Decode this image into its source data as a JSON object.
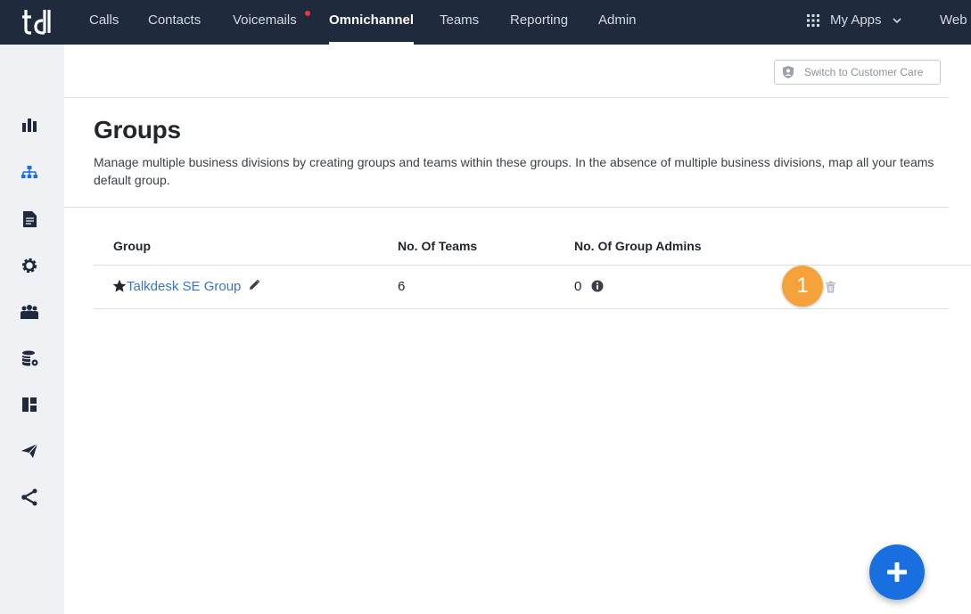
{
  "nav": {
    "items": [
      {
        "label": "Calls"
      },
      {
        "label": "Contacts"
      },
      {
        "label": "Voicemails"
      },
      {
        "label": "Omnichannel"
      },
      {
        "label": "Teams"
      },
      {
        "label": "Reporting"
      },
      {
        "label": "Admin"
      }
    ],
    "active": "Omnichannel",
    "my_apps": "My Apps",
    "web": "Web"
  },
  "sidebar": {
    "icons": [
      "bar-chart-icon",
      "org-chart-icon",
      "document-icon",
      "gear-icon",
      "users-icon",
      "database-settings-icon",
      "dashboard-icon",
      "send-icon",
      "share-icon"
    ],
    "active": "org-chart-icon"
  },
  "header": {
    "switch_label": "Switch to Customer Care"
  },
  "page": {
    "title": "Groups",
    "description_line1": "Manage multiple business divisions by creating groups and teams within these groups. In the absence of multiple business divisions, map all your teams",
    "description_line2": "default group."
  },
  "table": {
    "columns": [
      "Group",
      "No. Of Teams",
      "No. Of Group Admins"
    ],
    "rows": [
      {
        "group": "Talkdesk SE Group",
        "teams": "6",
        "admins": "0",
        "default": true
      }
    ]
  },
  "annotation": {
    "step": "1"
  },
  "colors": {
    "nav_bg": "#1f2a3c",
    "link": "#3b75c2",
    "accent": "#1a6fe0",
    "badge": "#f5a23b",
    "sidebar_active": "#1a6fe0"
  }
}
